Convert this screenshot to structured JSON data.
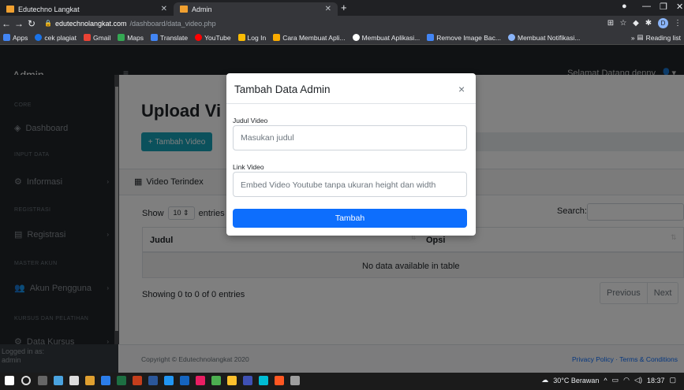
{
  "browser": {
    "tabs": [
      {
        "label": "Edutechno Langkat",
        "active": false
      },
      {
        "label": "Admin",
        "active": true
      }
    ],
    "url_domain": "edutechnolangkat.com",
    "url_path": "/dashboard/data_video.php",
    "bookmarks": [
      {
        "label": "Apps",
        "color": "#4285f4"
      },
      {
        "label": "cek plagiat",
        "color": "#1a73e8"
      },
      {
        "label": "Gmail",
        "color": "#ea4335"
      },
      {
        "label": "Maps",
        "color": "#34a853"
      },
      {
        "label": "Translate",
        "color": "#4285f4"
      },
      {
        "label": "YouTube",
        "color": "#ff0000"
      },
      {
        "label": "Log In",
        "color": "#fbbc04"
      },
      {
        "label": "Cara Membuat Apli...",
        "color": "#f9ab00"
      },
      {
        "label": "Membuat Aplikasi...",
        "color": "#ffffff"
      },
      {
        "label": "Remove Image Bac...",
        "color": "#4285f4"
      },
      {
        "label": "Membuat Notifikasi...",
        "color": "#8ab4f8"
      }
    ],
    "reading_list": "Reading list",
    "profile_initial": "D"
  },
  "app": {
    "brand": "Admin",
    "greeting": "Selamat Datang denny",
    "sidebar": [
      {
        "type": "heading",
        "label": "CORE"
      },
      {
        "type": "link",
        "label": "Dashboard",
        "icon": "dashboard-icon",
        "chev": false
      },
      {
        "type": "heading",
        "label": "INPUT DATA"
      },
      {
        "type": "link",
        "label": "Informasi",
        "icon": "info-icon",
        "chev": true
      },
      {
        "type": "heading",
        "label": "REGISTRASI"
      },
      {
        "type": "link",
        "label": "Registrasi",
        "icon": "registration-icon",
        "chev": true
      },
      {
        "type": "heading",
        "label": "MASTER AKUN"
      },
      {
        "type": "link",
        "label": "Akun Pengguna",
        "icon": "users-icon",
        "chev": true
      },
      {
        "type": "heading",
        "label": "KURSUS DAN PELATIHAN"
      },
      {
        "type": "link",
        "label": "Data Kursus",
        "icon": "course-icon",
        "chev": true
      }
    ],
    "logged_in_label": "Logged in as:",
    "logged_in_user": "admin",
    "page_title": "Upload Vi",
    "add_button": "Tambah Video",
    "card_title": "Video Terindex",
    "show_label": "Show",
    "entries_value": "10",
    "entries_label": "entries",
    "search_label": "Search:",
    "columns": [
      "Judul",
      "Opsi"
    ],
    "empty_message": "No data available in table",
    "info": "Showing 0 to 0 of 0 entries",
    "prev_label": "Previous",
    "next_label": "Next",
    "copyright": "Copyright © Edutechnolangkat 2020",
    "footer_links": "Privacy Policy · Terms & Conditions"
  },
  "modal": {
    "title": "Tambah Data Admin",
    "field1_label": "Judul Video",
    "field1_placeholder": "Masukan judul",
    "field2_label": "Link Video",
    "field2_placeholder": "Embed Video Youtube tanpa ukuran height dan width",
    "submit_label": "Tambah"
  },
  "taskbar": {
    "weather": "30°C Berawan",
    "clock": "18:37"
  },
  "colors": {
    "primary": "#0d6efd",
    "info": "#17a2b8",
    "dark": "#212529"
  }
}
